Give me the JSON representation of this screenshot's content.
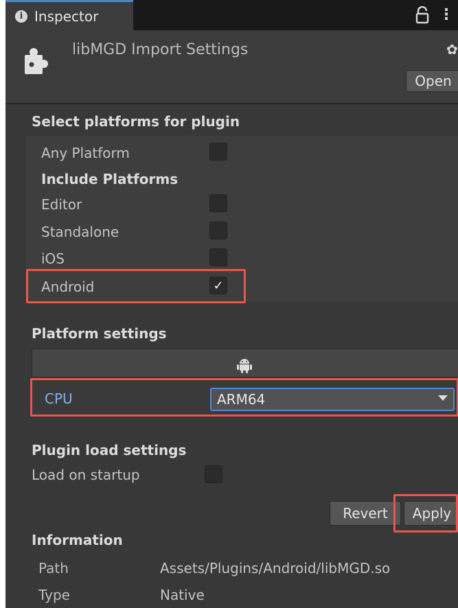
{
  "tab": {
    "title": "Inspector",
    "info_icon": "i"
  },
  "header": {
    "title": "libMGD Import Settings",
    "open_label": "Open"
  },
  "select_platforms": {
    "title": "Select platforms for plugin",
    "any_platform": {
      "label": "Any Platform",
      "checked": false
    },
    "include_heading": "Include Platforms",
    "platforms": [
      {
        "label": "Editor",
        "checked": false
      },
      {
        "label": "Standalone",
        "checked": false
      },
      {
        "label": "iOS",
        "checked": false
      },
      {
        "label": "Android",
        "checked": true
      }
    ]
  },
  "platform_settings": {
    "title": "Platform settings",
    "active_tab_icon": "android-icon",
    "cpu_label": "CPU",
    "cpu_value": "ARM64"
  },
  "plugin_load": {
    "title": "Plugin load settings",
    "load_on_startup": {
      "label": "Load on startup",
      "checked": false
    }
  },
  "actions": {
    "revert_label": "Revert",
    "apply_label": "Apply"
  },
  "information": {
    "title": "Information",
    "rows": [
      {
        "key": "Path",
        "value": "Assets/Plugins/Android/libMGD.so"
      },
      {
        "key": "Type",
        "value": "Native"
      }
    ]
  },
  "colors": {
    "panel": "#383838",
    "accent_blue": "#4d8ad6",
    "highlight_red": "#e8574a",
    "label_blue": "#7eb2f2"
  }
}
